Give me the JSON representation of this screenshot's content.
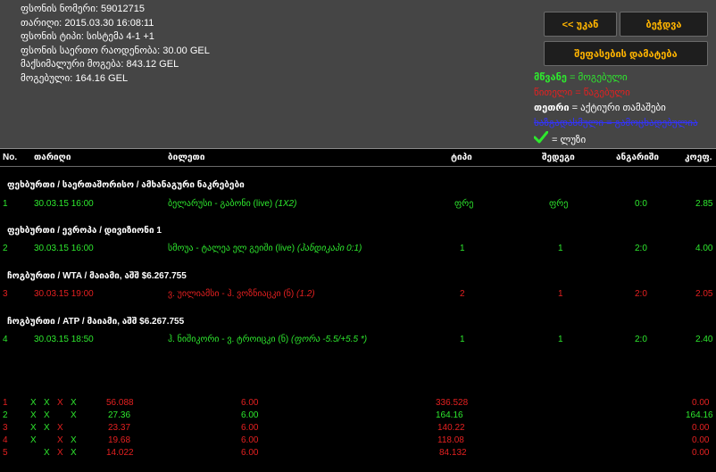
{
  "info": [
    {
      "label": "ფსონის ნომერი:",
      "value": "59012715"
    },
    {
      "label": "თარიღი:",
      "value": "2015.03.30 16:08:11"
    },
    {
      "label": "ფსონის ტიპი:",
      "value": "სისტემა 4-1 +1"
    },
    {
      "label": "ფსონის საერთო რაოდენობა:",
      "value": "30.00 GEL"
    },
    {
      "label": "მაქსიმალური მოგება:",
      "value": "843.12 GEL"
    },
    {
      "label": "მოგებული:",
      "value": "164.16 GEL"
    }
  ],
  "buttons": {
    "back": "<< უკან",
    "print": "ბეჭდვა",
    "rate": "შეფასების დამატება"
  },
  "legend": {
    "green_word": "მწვანე",
    "green_text": " = მოგებული",
    "red_text": "წითელი = წაგებული",
    "white_word": "თეთრი",
    "white_text": " = აქტიური თამაშები",
    "blue_text": "ხაზგადასმული = გამოცხადებულია",
    "check_text": "= ლუზი"
  },
  "header": {
    "no": "No.",
    "date": "თარიღი",
    "event": "ბილეთი",
    "type": "ტიპი",
    "result": "შედეგი",
    "score": "ანგარიში",
    "odds": "კოეფ."
  },
  "sections": [
    {
      "title": "ფეხბურთი / საერთაშორისო / ამხანაგური ნაკრებები"
    },
    {
      "title": "ფეხბურთი / ევროპა / დივიზიონი 1"
    },
    {
      "title": "ჩოგბურთი / WTA / მაიამი, აშშ $6.267.755"
    },
    {
      "title": "ჩოგბურთი / ATP / მაიამი, აშშ $6.267.755"
    }
  ],
  "bets": [
    {
      "no": "1",
      "date": "30.03.15 16:00",
      "event": "ბელარუსი - გაბონი (live)",
      "market": "(1X2)",
      "type": "ფრე",
      "result": "ფრე",
      "score": "0:0",
      "odds": "2.85",
      "status": "won"
    },
    {
      "no": "2",
      "date": "30.03.15 16:00",
      "event": "სმოუა - ტალეა ელ გეიში (live)",
      "market": "(ჰანდიკაპი 0:1)",
      "type": "1",
      "result": "1",
      "score": "2:0",
      "odds": "4.00",
      "status": "won"
    },
    {
      "no": "3",
      "date": "30.03.15 19:00",
      "event": "ვ. უილიამსი - ჰ. ვოზნიაცკი (ნ)",
      "market": "(1.2)",
      "type": "2",
      "result": "1",
      "score": "2:0",
      "odds": "2.05",
      "status": "lost"
    },
    {
      "no": "4",
      "date": "30.03.15 18:50",
      "event": "ჰ. ნიშიკორი - ვ. ტროიცკი (ნ)",
      "market": "(ფორა -5.5/+5.5 *)",
      "type": "1",
      "result": "1",
      "score": "2:0",
      "odds": "2.40",
      "status": "won"
    }
  ],
  "combos": [
    {
      "no": "1",
      "marks": [
        "X",
        "X",
        "X",
        "X"
      ],
      "coef": "56.088",
      "stake": "6.00",
      "max": "336.528",
      "won": "0.00",
      "status": "lost"
    },
    {
      "no": "2",
      "marks": [
        "X",
        "X",
        "",
        "X"
      ],
      "coef": "27.36",
      "stake": "6.00",
      "max": "164.16",
      "won": "164.16",
      "status": "won"
    },
    {
      "no": "3",
      "marks": [
        "X",
        "X",
        "X",
        ""
      ],
      "coef": "23.37",
      "stake": "6.00",
      "max": "140.22",
      "won": "0.00",
      "status": "lost"
    },
    {
      "no": "4",
      "marks": [
        "X",
        "",
        "X",
        "X"
      ],
      "coef": "19.68",
      "stake": "6.00",
      "max": "118.08",
      "won": "0.00",
      "status": "lost"
    },
    {
      "no": "5",
      "marks": [
        "",
        "X",
        "X",
        "X"
      ],
      "coef": "14.022",
      "stake": "6.00",
      "max": "84.132",
      "won": "0.00",
      "status": "lost"
    }
  ],
  "colors": {
    "won": "#2ee82e",
    "lost": "#e42020",
    "button_text": "#ffb400",
    "panel_bg": "#454545"
  }
}
